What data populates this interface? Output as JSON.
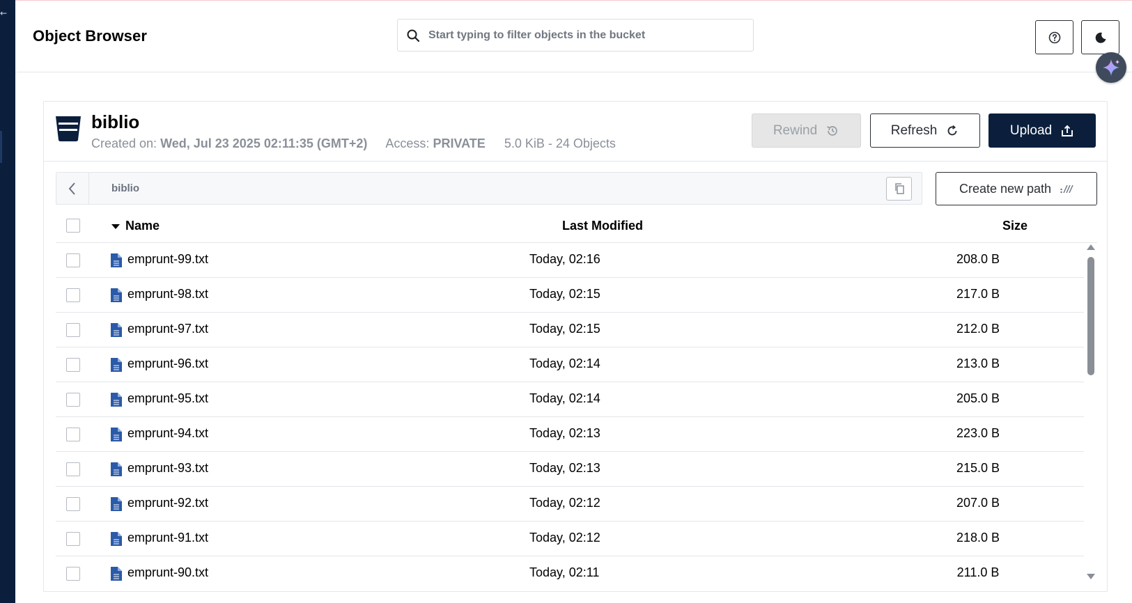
{
  "header": {
    "title": "Object Browser",
    "search_placeholder": "Start typing to filter objects in the bucket"
  },
  "bucket": {
    "name": "biblio",
    "created_label": "Created on:",
    "created_value": "Wed, Jul 23 2025 02:11:35 (GMT+2)",
    "access_label": "Access:",
    "access_value": "PRIVATE",
    "usage": "5.0 KiB - 24 Objects"
  },
  "actions": {
    "rewind_label": "Rewind",
    "refresh_label": "Refresh",
    "upload_label": "Upload",
    "create_path_label": "Create new path"
  },
  "path": {
    "crumb": "biblio"
  },
  "table": {
    "headers": {
      "name": "Name",
      "modified": "Last Modified",
      "size": "Size"
    },
    "rows": [
      {
        "name": "emprunt-99.txt",
        "modified": "Today, 02:16",
        "size": "208.0 B"
      },
      {
        "name": "emprunt-98.txt",
        "modified": "Today, 02:15",
        "size": "217.0 B"
      },
      {
        "name": "emprunt-97.txt",
        "modified": "Today, 02:15",
        "size": "212.0 B"
      },
      {
        "name": "emprunt-96.txt",
        "modified": "Today, 02:14",
        "size": "213.0 B"
      },
      {
        "name": "emprunt-95.txt",
        "modified": "Today, 02:14",
        "size": "205.0 B"
      },
      {
        "name": "emprunt-94.txt",
        "modified": "Today, 02:13",
        "size": "223.0 B"
      },
      {
        "name": "emprunt-93.txt",
        "modified": "Today, 02:13",
        "size": "215.0 B"
      },
      {
        "name": "emprunt-92.txt",
        "modified": "Today, 02:12",
        "size": "207.0 B"
      },
      {
        "name": "emprunt-91.txt",
        "modified": "Today, 02:12",
        "size": "218.0 B"
      },
      {
        "name": "emprunt-90.txt",
        "modified": "Today, 02:11",
        "size": "211.0 B"
      }
    ]
  },
  "icons": {
    "search": "search-icon",
    "help": "help-icon",
    "theme": "moon-icon",
    "ai": "sparkle-icon",
    "bucket": "bucket-icon",
    "rewind": "history-icon",
    "refresh": "refresh-icon",
    "upload": "upload-icon",
    "back": "chevron-left-icon",
    "copy": "copy-icon",
    "new_path": "new-path-icon",
    "file": "file-text-icon"
  },
  "colors": {
    "sidebar": "#0b1f3d",
    "primary": "#0b1f3d",
    "file_icon": "#2b5aa8",
    "muted_text": "#8a9099"
  }
}
